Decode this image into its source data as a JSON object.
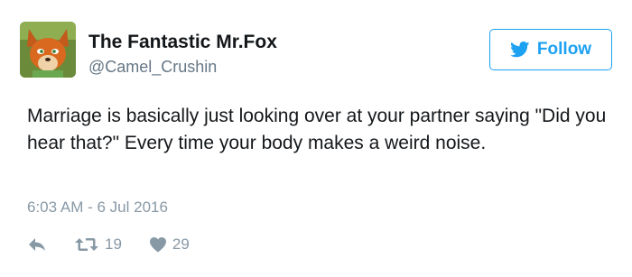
{
  "user": {
    "display_name": "The Fantastic Mr.Fox",
    "handle": "@Camel_Crushin",
    "avatar_icon": "fox-avatar"
  },
  "follow_button": {
    "label": "Follow",
    "icon": "twitter-bird-icon"
  },
  "tweet": {
    "text": "Marriage is basically just looking over at your partner saying \"Did you hear that?\" Every time your body makes a weird noise.",
    "timestamp": "6:03 AM - 6 Jul 2016"
  },
  "actions": {
    "reply_icon": "reply-icon",
    "retweet_icon": "retweet-icon",
    "retweet_count": "19",
    "like_icon": "heart-icon",
    "like_count": "29"
  },
  "colors": {
    "accent": "#1da1f2",
    "text": "#14171a",
    "muted": "#8899a6",
    "handle": "#657786"
  }
}
